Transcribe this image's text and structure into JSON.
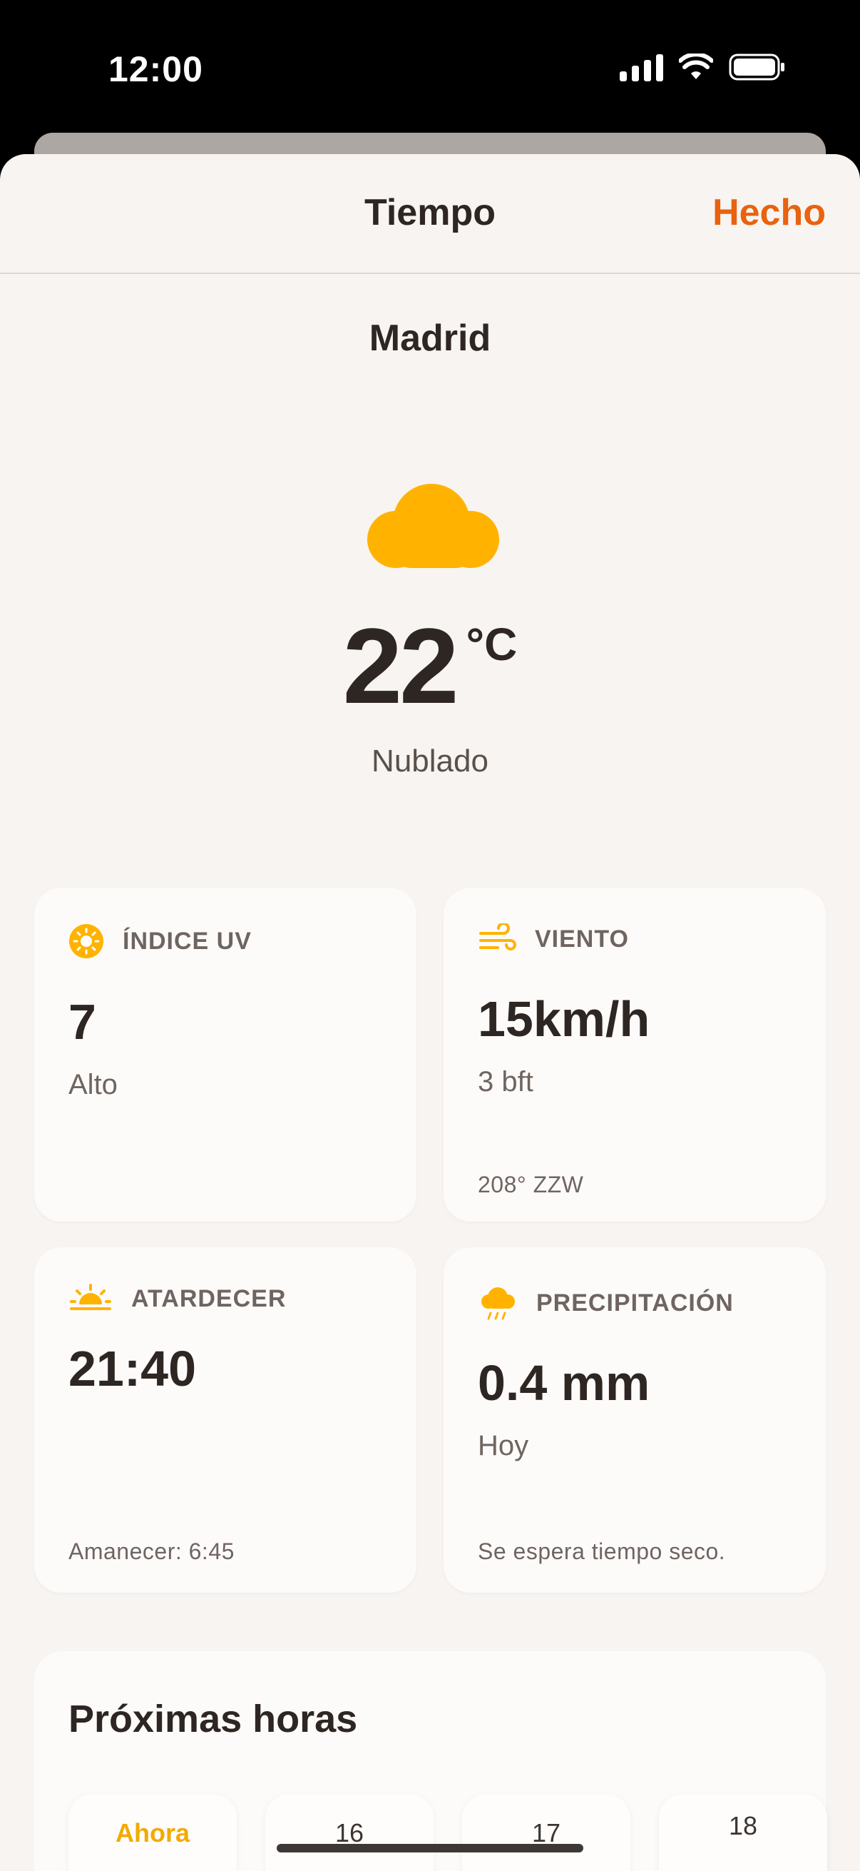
{
  "status_bar": {
    "time": "12:00"
  },
  "nav": {
    "title": "Tiempo",
    "done_label": "Hecho"
  },
  "location": {
    "city": "Madrid"
  },
  "current": {
    "temperature": "22",
    "unit": "°C",
    "condition": "Nublado",
    "icon": "cloud-icon"
  },
  "cards": {
    "uv": {
      "label": "ÍNDICE UV",
      "value": "7",
      "sub": "Alto",
      "icon": "sun-icon"
    },
    "wind": {
      "label": "VIENTO",
      "value": "15km/h",
      "sub": "3 bft",
      "footer": "208° ZZW",
      "icon": "wind-icon"
    },
    "sunset": {
      "label": "ATARDECER",
      "value": "21:40",
      "footer": "Amanecer: 6:45",
      "icon": "sunset-icon"
    },
    "precipitation": {
      "label": "PRECIPITACIÓN",
      "value": "0.4 mm",
      "sub": "Hoy",
      "footer": "Se espera tiempo seco.",
      "icon": "cloud-rain-icon"
    }
  },
  "hourly": {
    "title": "Próximas horas",
    "hours": [
      "Ahora",
      "16",
      "17",
      "18"
    ]
  },
  "colors": {
    "accent": "#e8620f",
    "icon_yellow": "#ffb300",
    "background": "#f7f4f1"
  }
}
